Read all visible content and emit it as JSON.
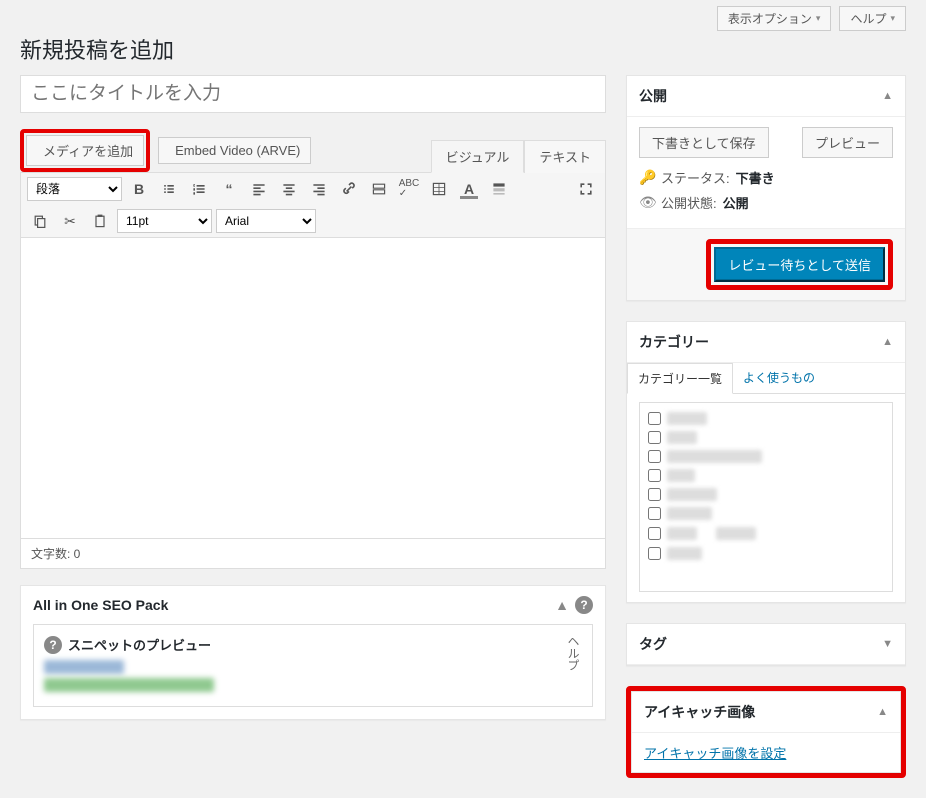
{
  "top": {
    "screen_options": "表示オプション",
    "help": "ヘルプ"
  },
  "page_title": "新規投稿を追加",
  "title_placeholder": "ここにタイトルを入力",
  "media_button": "メディアを追加",
  "embed_button": "Embed Video (ARVE)",
  "editor_tabs": {
    "visual": "ビジュアル",
    "text": "テキスト"
  },
  "toolbar": {
    "paragraph": "段落",
    "font_size": "11pt",
    "font_family": "Arial"
  },
  "word_count_label": "文字数: 0",
  "publish": {
    "box_title": "公開",
    "save_draft": "下書きとして保存",
    "preview": "プレビュー",
    "status_label": "ステータス:",
    "status_value": "下書き",
    "visibility_label": "公開状態:",
    "visibility_value": "公開",
    "submit": "レビュー待ちとして送信"
  },
  "categories": {
    "box_title": "カテゴリー",
    "tab_all": "カテゴリー一覧",
    "tab_freq": "よく使うもの",
    "items_count": 8
  },
  "tags": {
    "box_title": "タグ"
  },
  "featured": {
    "box_title": "アイキャッチ画像",
    "set_link": "アイキャッチ画像を設定"
  },
  "seo": {
    "box_title": "All in One SEO Pack",
    "snippet_label": "スニペットのプレビュー",
    "help_vert": "ヘルプ"
  }
}
